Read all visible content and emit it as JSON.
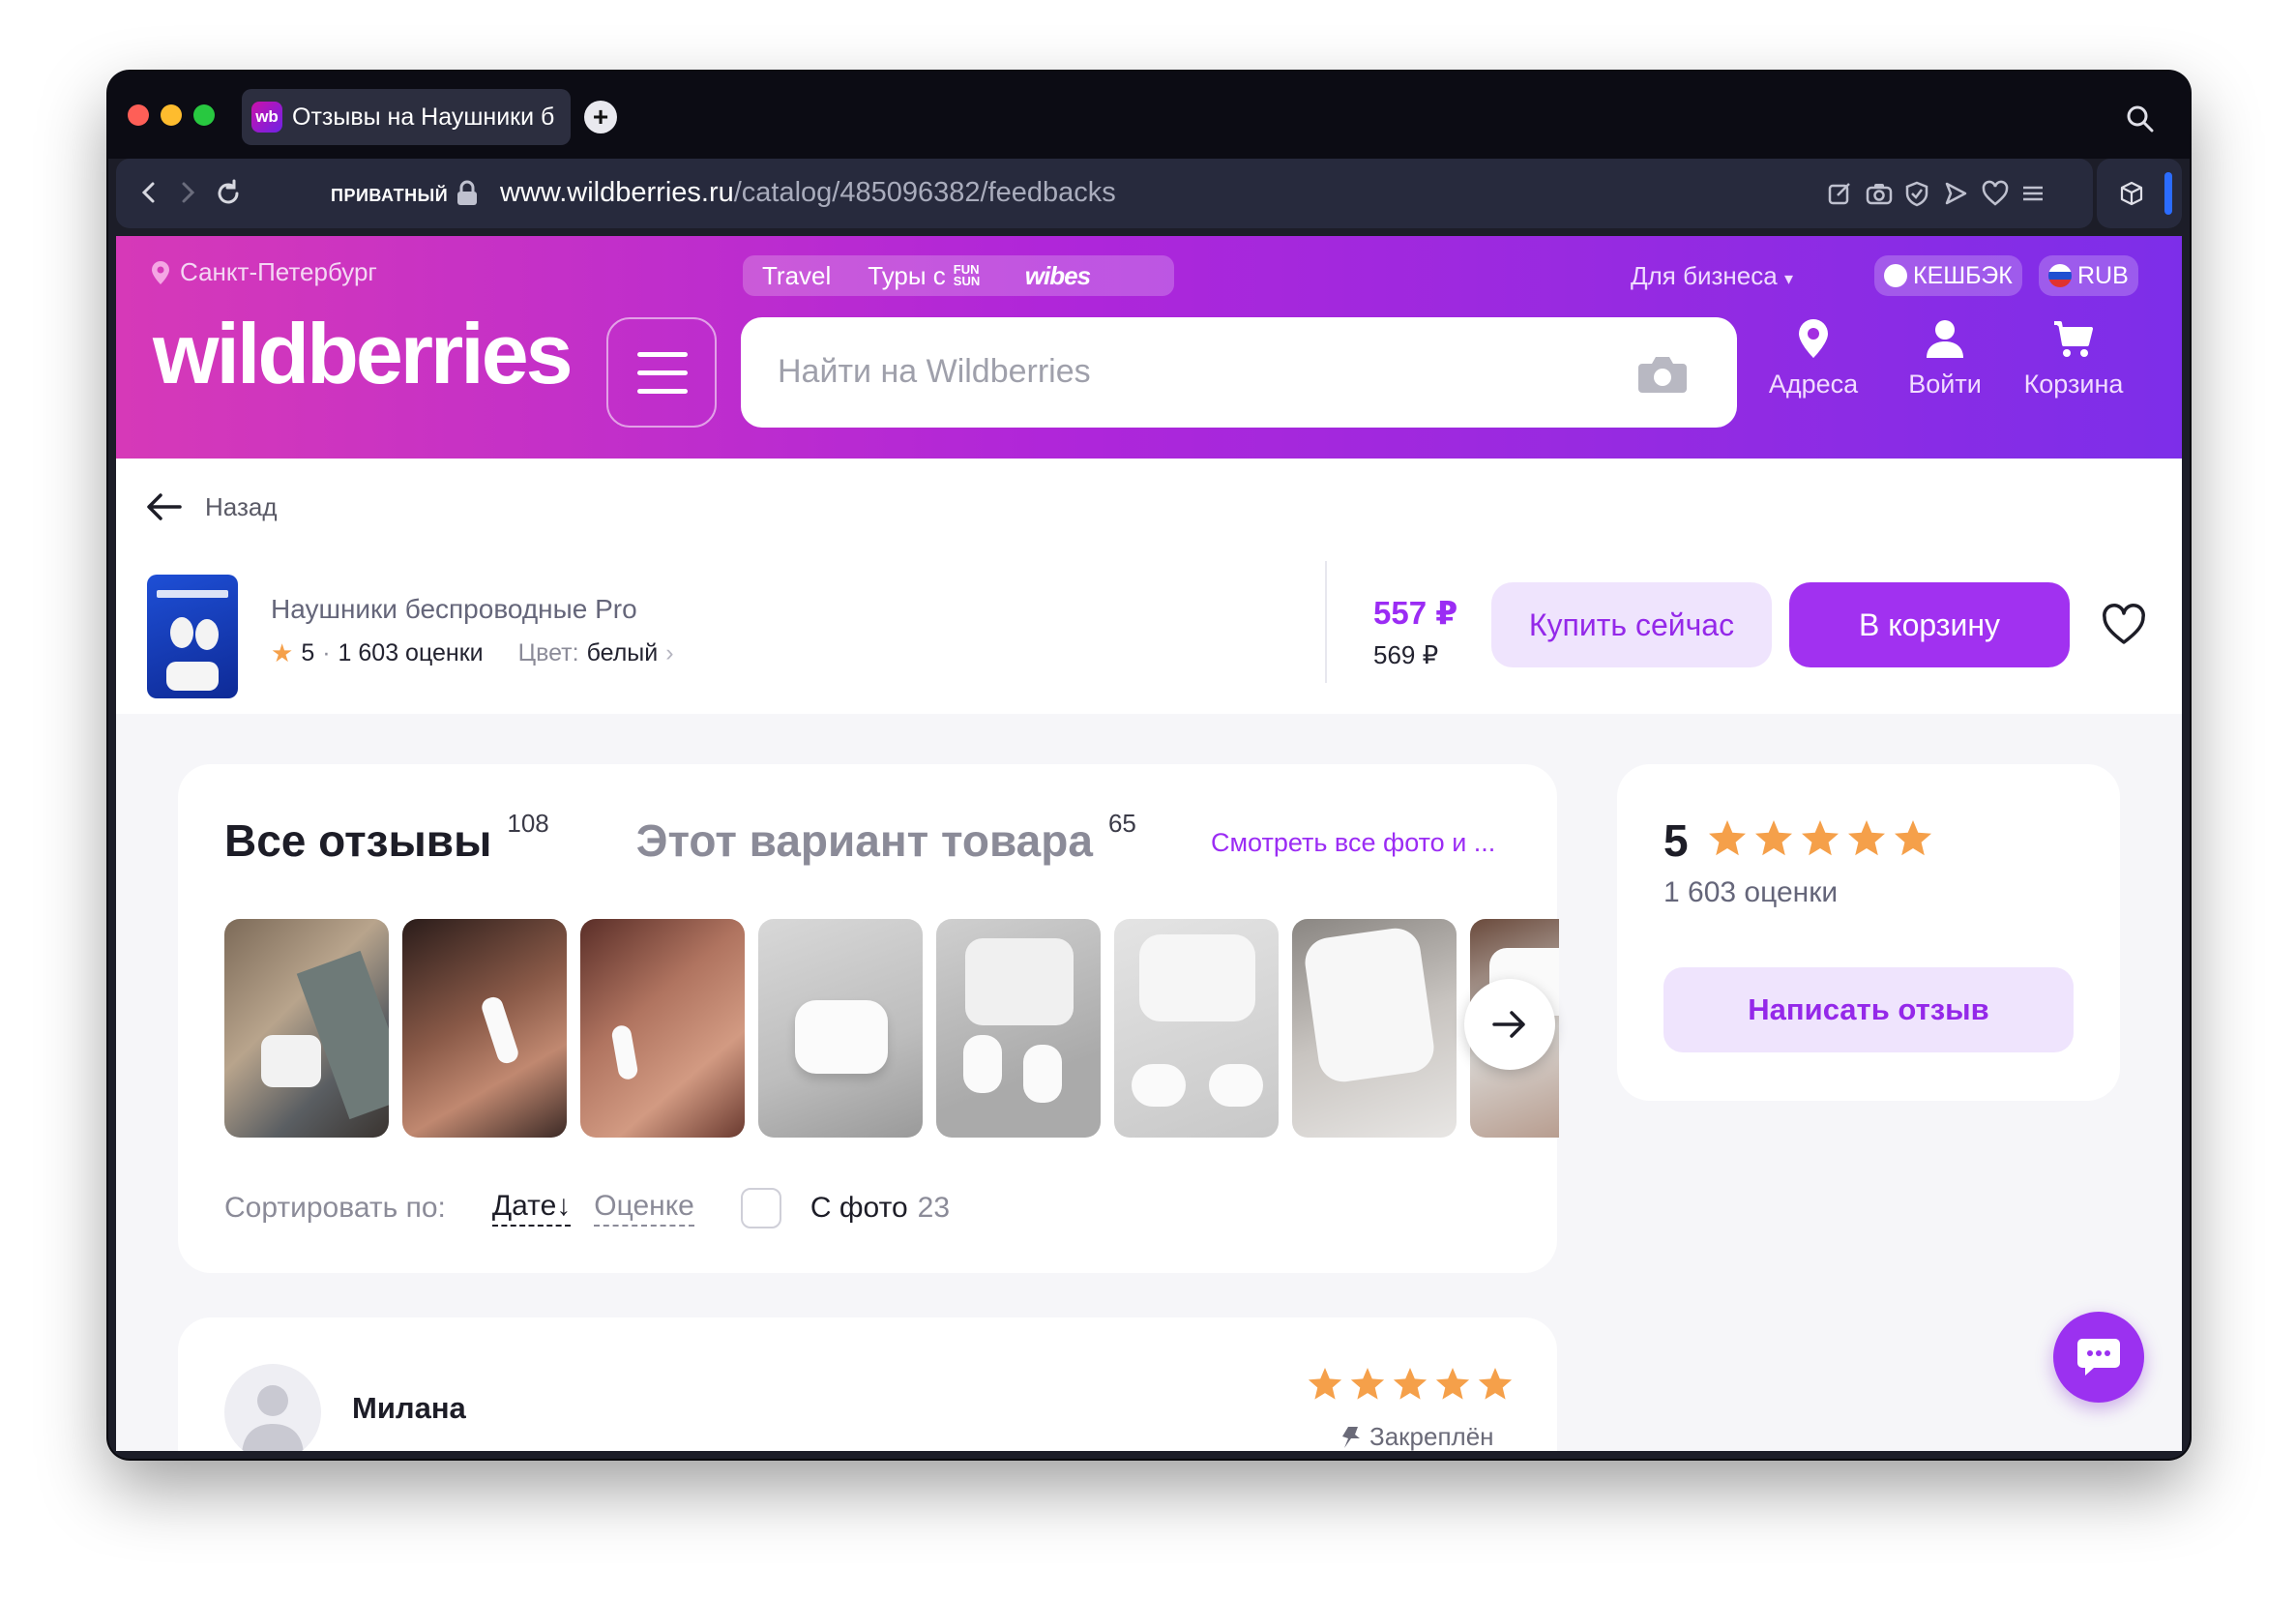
{
  "browser": {
    "tab_title": "Отзывы на Наушники б",
    "favicon_text": "wb",
    "private_label": "ПРИВАТНЫЙ",
    "url_domain": "www.wildberries.ru",
    "url_path": "/catalog/485096382/feedbacks"
  },
  "header": {
    "city": "Санкт-Петербург",
    "promo_travel": "Travel",
    "promo_tours": "Туры с",
    "promo_funsun": "FUN SUN",
    "promo_wibes": "wibes",
    "business": "Для бизнеса",
    "cashback": "КЕШБЭК",
    "currency": "RUB",
    "logo": "wildberries",
    "search_placeholder": "Найти на Wildberries",
    "nav_addresses": "Адреса",
    "nav_login": "Войти",
    "nav_cart": "Корзина"
  },
  "product": {
    "back": "Назад",
    "name": "Наушники беспроводные Pro",
    "rating": "5",
    "ratings_count": "1 603 оценки",
    "color_label": "Цвет:",
    "color_value": "белый",
    "price": "557 ₽",
    "old_price": "569 ₽",
    "buy_now": "Купить сейчас",
    "add_to_cart": "В корзину"
  },
  "reviews": {
    "tab_all": "Все отзывы",
    "tab_all_count": "108",
    "tab_variant": "Этот вариант товара",
    "tab_variant_count": "65",
    "see_all_photos": "Смотреть все фото и ...",
    "sort_label": "Сортировать по:",
    "sort_date": "Дате",
    "sort_rating": "Оценке",
    "with_photo": "С фото",
    "with_photo_count": "23"
  },
  "summary": {
    "rating": "5",
    "stars": 5,
    "ratings_count": "1 603 оценки",
    "write_review": "Написать отзыв"
  },
  "review": {
    "author": "Милана",
    "stars": 5,
    "pinned": "Закреплён"
  },
  "colors": {
    "accent": "#a131f0",
    "header_gradient_start": "#d639b8",
    "header_gradient_end": "#7d2ee9",
    "star": "#f5a04a"
  }
}
